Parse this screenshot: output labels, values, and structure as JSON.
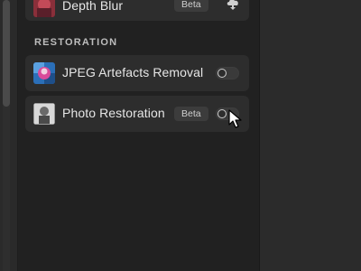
{
  "filters_panel": {
    "top_item": {
      "label": "Depth Blur",
      "badge": "Beta",
      "action_icon": "cloud-download-icon"
    },
    "section": {
      "title": "RESTORATION",
      "items": [
        {
          "label": "JPEG Artefacts Removal",
          "badge": "",
          "enabled": false,
          "thumb_icon": "jpeg-artefacts-thumbnail"
        },
        {
          "label": "Photo Restoration",
          "badge": "Beta",
          "enabled": false,
          "thumb_icon": "photo-restoration-thumbnail"
        }
      ]
    }
  },
  "colors": {
    "panel_bg": "#212121",
    "card_bg": "#2d2d2d",
    "text": "#e6e6e6",
    "section_text": "#bdbdbd",
    "badge_bg": "#3c3c3c"
  }
}
